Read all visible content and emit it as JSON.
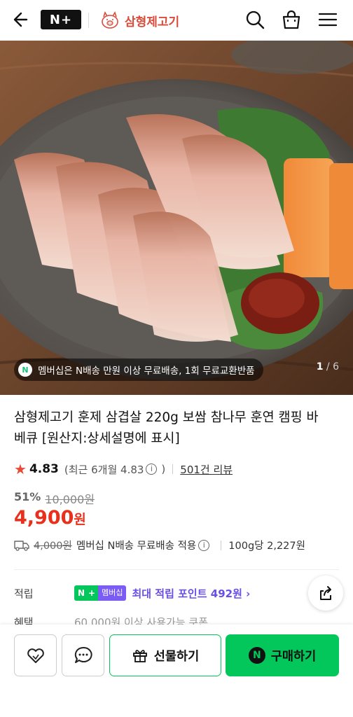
{
  "header": {
    "nplus_logo": "N+",
    "brand_name": "삼형제고기",
    "icons": [
      "back-arrow-icon",
      "search-icon",
      "shopping-bag-icon",
      "menu-icon"
    ]
  },
  "hero": {
    "notice_badge": "N",
    "notice": "멤버십은 N배송 만원 이상 무료배송, 1회 무료교환반품",
    "page_current": "1",
    "page_total": "6"
  },
  "product": {
    "title": "삼형제고기 훈제 삼겹살 220g 보쌈 참나무 훈연 캠핑 바베큐 [원산지:상세설명에 표시]",
    "rating": "4.83",
    "recent_rating": "(최근 6개월 4.83",
    "recent_close": ")",
    "review_link": "501건 리뷰",
    "discount": "51%",
    "original_price": "10,000원",
    "price": "4,900",
    "price_unit": "원",
    "shipping_strike": "4,000원",
    "shipping_text": "멤버십 N배송 무료배송 적용",
    "unit_price": "100g당 2,227원"
  },
  "points": {
    "label": "적립",
    "badge_n": "N",
    "badge_plus": "+",
    "badge_member": "멤버십",
    "text": "최대 적립 포인트 492원 ›"
  },
  "benefit": {
    "label": "혜택",
    "text": "60,000원 이상 사용가능 쿠폰"
  },
  "bottom_bar": {
    "gift_label": "선물하기",
    "buy_label": "구매하기",
    "buy_badge": "N"
  },
  "colors": {
    "brand_red": "#d94b3b",
    "price_red": "#e8301c",
    "naver_green": "#03c75a",
    "point_purple": "#6a4ee8"
  }
}
